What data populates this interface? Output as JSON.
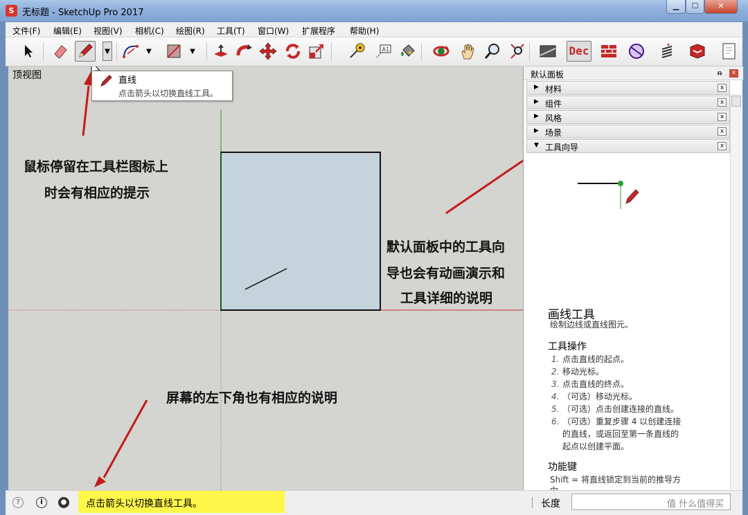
{
  "window": {
    "title": "无标题 - SketchUp Pro 2017",
    "app_icon": "S",
    "minimize": "▁",
    "maximize": "☐",
    "close": "✕"
  },
  "menu": [
    "文件(F)",
    "编辑(E)",
    "视图(V)",
    "相机(C)",
    "绘图(R)",
    "工具(T)",
    "窗口(W)",
    "扩展程序",
    "帮助(H)"
  ],
  "toolbar": {
    "icons": [
      "select-icon",
      "eraser-icon",
      "pencil-line-icon",
      "arc-icon",
      "rectangle-icon",
      "push-pull-icon",
      "follow-me-icon",
      "move-icon",
      "rotate-icon",
      "scale-icon",
      "tape-measure-icon",
      "text-icon",
      "paint-bucket-icon",
      "orbit-icon",
      "pan-icon",
      "zoom-icon",
      "zoom-extents-icon",
      "texture-icon",
      "dec-icon",
      "layout-icon",
      "sphere-icon",
      "spring-icon",
      "warehouse-icon",
      "page-icon"
    ],
    "dec_label": "Dec",
    "text_tool_label": "A1"
  },
  "viewport": {
    "view_label": "顶视图",
    "tooltip_title": "直线",
    "tooltip_desc": "点击箭头以切换直线工具。",
    "annotation_toolbar_line1": "鼠标停留在工具栏图标上",
    "annotation_toolbar_line2": "时会有相应的提示",
    "annotation_panel_line1": "默认面板中的工具向",
    "annotation_panel_line2": "导也会有动画演示和",
    "annotation_panel_line3": "工具详细的说明",
    "annotation_status": "屏幕的左下角也有相应的说明",
    "colors": {
      "face": "#c5d3dd",
      "arrow": "#c41a1a",
      "axis_red": "#d03030",
      "axis_green": "#2aa02a"
    }
  },
  "tray": {
    "title": "默认面板",
    "pin": "ᵰ",
    "sections": [
      {
        "label": "材料",
        "arrow": "▶"
      },
      {
        "label": "组件",
        "arrow": "▶"
      },
      {
        "label": "风格",
        "arrow": "▶"
      },
      {
        "label": "场景",
        "arrow": "▶"
      },
      {
        "label": "工具向导",
        "arrow": "▼"
      }
    ],
    "close_glyph": "x",
    "instructor": {
      "title": "画线工具",
      "subtitle": "绘制边线或直线图元。",
      "ops_heading": "工具操作",
      "steps": [
        {
          "n": "1.",
          "text": "点击直线的起点。"
        },
        {
          "n": "2.",
          "text": "移动光标。"
        },
        {
          "n": "3.",
          "text": "点击直线的终点。"
        },
        {
          "n": "4.",
          "text": "（可选）移动光标。"
        },
        {
          "n": "5.",
          "text": "（可选）点击创建连接的直线。"
        },
        {
          "n": "6.",
          "text": "（可选）重复步骤 4 以创建连接"
        }
      ],
      "step6_cont1": "的直线，或返回至第一条直线的",
      "step6_cont2": "起点以创建平面。",
      "keys_heading": "功能键",
      "key_shift": "Shift = 将直线锁定到当前的推导方",
      "key_shift_cont": "向"
    }
  },
  "statusbar": {
    "status_text": "点击箭头以切换直线工具。",
    "measure_label": "长度",
    "watermark": "值 什么值得买",
    "highlight_color": "#fff84a"
  }
}
